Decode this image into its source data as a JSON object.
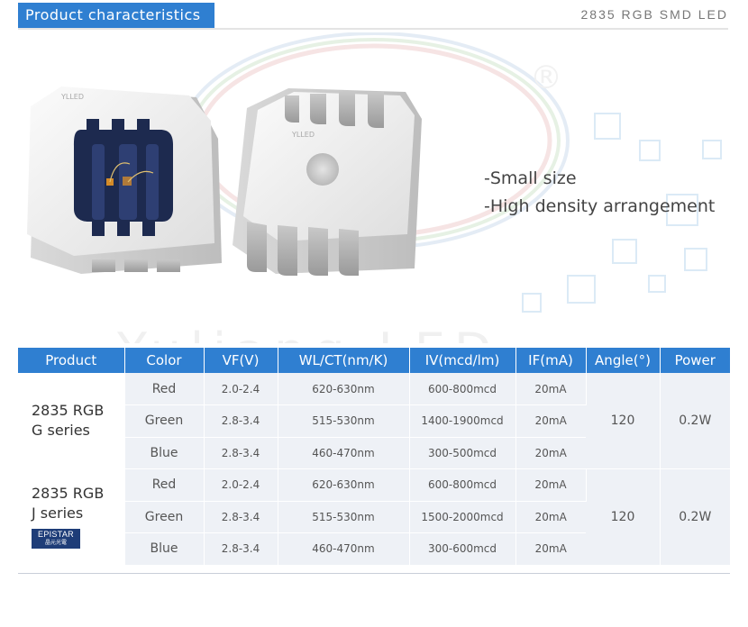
{
  "header": {
    "section_label": "Product characteristics",
    "product_title": "2835 RGB SMD LED"
  },
  "hero": {
    "led_marking": "YLLED",
    "features": [
      "-Small size",
      "-High density arrangement"
    ],
    "watermark": "Yuliang LED",
    "logo_mark": "®"
  },
  "table": {
    "headers": [
      "Product",
      "Color",
      "VF(V)",
      "WL/CT(nm/K)",
      "IV(mcd/lm)",
      "IF(mA)",
      "Angle(°)",
      "Power"
    ],
    "groups": [
      {
        "product_line1": "2835 RGB",
        "product_line2": "G  series",
        "angle": "120",
        "power": "0.2W",
        "rows": [
          {
            "color": "Red",
            "vf": "2.0-2.4",
            "wl": "620-630nm",
            "iv": "600-800mcd",
            "if": "20mA"
          },
          {
            "color": "Green",
            "vf": "2.8-3.4",
            "wl": "515-530nm",
            "iv": "1400-1900mcd",
            "if": "20mA"
          },
          {
            "color": "Blue",
            "vf": "2.8-3.4",
            "wl": "460-470nm",
            "iv": "300-500mcd",
            "if": "20mA"
          }
        ]
      },
      {
        "product_line1": "2835 RGB",
        "product_line2": "J  series",
        "badge_line1": "EPISTAR",
        "badge_line2": "晶元光電",
        "angle": "120",
        "power": "0.2W",
        "rows": [
          {
            "color": "Red",
            "vf": "2.0-2.4",
            "wl": "620-630nm",
            "iv": "600-800mcd",
            "if": "20mA"
          },
          {
            "color": "Green",
            "vf": "2.8-3.4",
            "wl": "515-530nm",
            "iv": "1500-2000mcd",
            "if": "20mA"
          },
          {
            "color": "Blue",
            "vf": "2.8-3.4",
            "wl": "460-470nm",
            "iv": "300-600mcd",
            "if": "20mA"
          }
        ]
      }
    ]
  },
  "colors": {
    "accent": "#2f7fd1",
    "red": "#e0262b",
    "green": "#38c33d",
    "blue": "#3c5f8c",
    "cell_bg": "#eef1f6",
    "badge_bg": "#1e3d78"
  }
}
